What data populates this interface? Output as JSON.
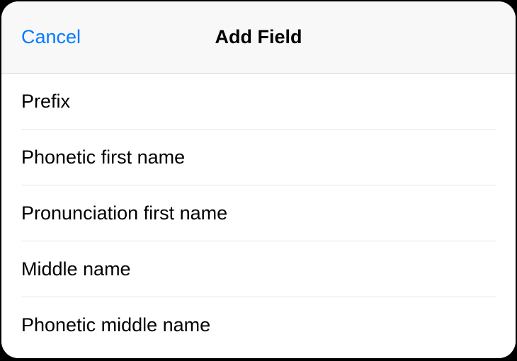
{
  "header": {
    "cancel_label": "Cancel",
    "title": "Add Field"
  },
  "fields": [
    {
      "label": "Prefix"
    },
    {
      "label": "Phonetic first name"
    },
    {
      "label": "Pronunciation first name"
    },
    {
      "label": "Middle name"
    },
    {
      "label": "Phonetic middle name"
    }
  ]
}
